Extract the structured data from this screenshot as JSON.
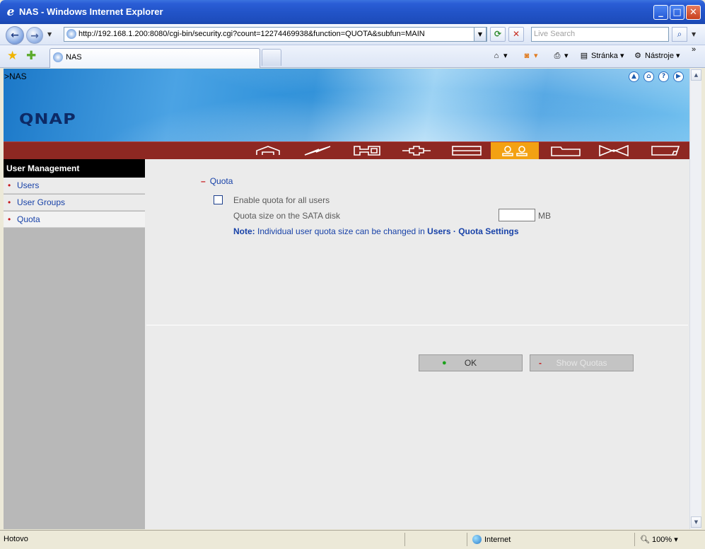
{
  "window": {
    "title": "NAS - Windows Internet Explorer",
    "minimize_label": "_",
    "maximize_label": "□",
    "close_label": "✕"
  },
  "addressbar": {
    "url": "http://192.168.1.200:8080/cgi-bin/security.cgi?count=12274469938&function=QUOTA&subfun=MAIN",
    "search_placeholder": "Live Search"
  },
  "tabs": [
    {
      "label": "NAS"
    }
  ],
  "commandbar": {
    "page_label": "Stránka",
    "tools_label": "Nástroje",
    "overflow": "»"
  },
  "banner": {
    "breadcrumb": ">NAS",
    "logo": "QNAP",
    "top_icons": [
      "up-icon",
      "home-icon",
      "help-icon",
      "next-icon"
    ]
  },
  "navbar": {
    "items": [
      {
        "icon": "home-nav-icon",
        "active": false
      },
      {
        "icon": "network-nav-icon",
        "active": false
      },
      {
        "icon": "system-tools-nav-icon",
        "active": false
      },
      {
        "icon": "device-nav-icon",
        "active": false
      },
      {
        "icon": "disk-nav-icon",
        "active": false
      },
      {
        "icon": "users-nav-icon",
        "active": true
      },
      {
        "icon": "share-folder-nav-icon",
        "active": false
      },
      {
        "icon": "services-nav-icon",
        "active": false
      },
      {
        "icon": "status-nav-icon",
        "active": false
      }
    ],
    "active_color": "#F3A113",
    "bar_color": "#8E2822"
  },
  "sidebar": {
    "heading": "User Management",
    "items": [
      {
        "label": "Users",
        "active": false
      },
      {
        "label": "User Groups",
        "active": false
      },
      {
        "label": "Quota",
        "active": true
      }
    ]
  },
  "quota": {
    "section_title": "Quota",
    "enable_label": "Enable quota for all users",
    "enable_checked": false,
    "size_label": "Quota size on the SATA disk",
    "size_value": "",
    "size_unit": "MB",
    "note_prefix": "Note:",
    "note_text": " Individual user quota size can be changed in ",
    "note_link1": "Users",
    "note_sep": " · ",
    "note_link2": "Quota Settings",
    "ok_label": "OK",
    "show_label": "Show Quotas"
  },
  "statusbar": {
    "status": "Hotovo",
    "zone": "Internet",
    "zoom": "100%"
  }
}
